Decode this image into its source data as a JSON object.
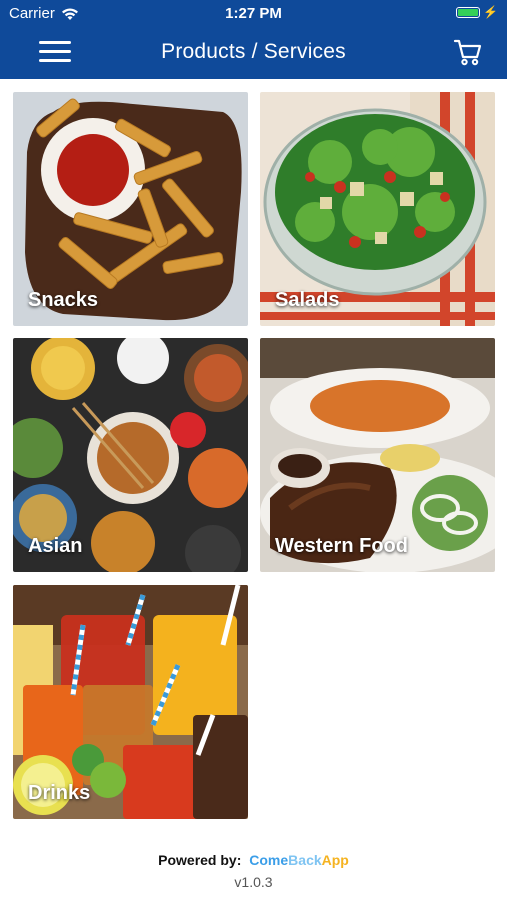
{
  "status_bar": {
    "carrier": "Carrier",
    "time": "1:27 PM"
  },
  "nav": {
    "title": "Products / Services"
  },
  "categories": [
    {
      "label": "Snacks"
    },
    {
      "label": "Salads"
    },
    {
      "label": "Asian"
    },
    {
      "label": "Western Food"
    },
    {
      "label": "Drinks"
    }
  ],
  "footer": {
    "powered_by": "Powered by:",
    "brand_come": "Come",
    "brand_back": "Back",
    "brand_app": "App",
    "version": "v1.0.3"
  },
  "colors": {
    "nav_bar": "#0f4a9a",
    "brand_blue": "#3b9ee8",
    "brand_orange": "#f5b321"
  }
}
